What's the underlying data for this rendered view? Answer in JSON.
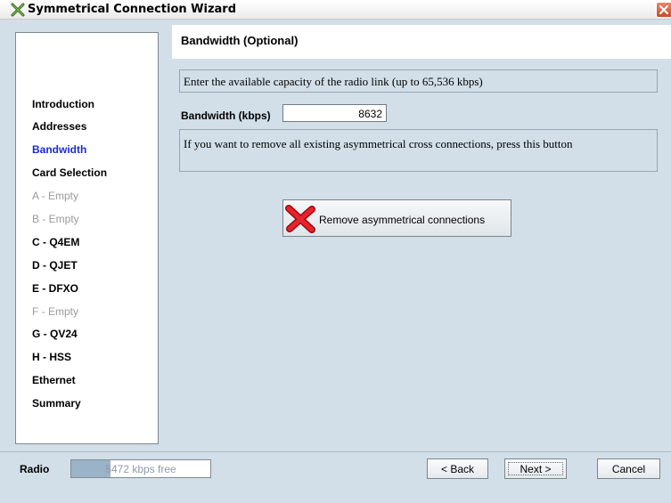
{
  "window": {
    "title": "Symmetrical Connection Wizard",
    "icon": "wizard-app-icon",
    "close_icon": "close-icon"
  },
  "nav": {
    "items": [
      {
        "label": "Introduction",
        "state": "done"
      },
      {
        "label": "Addresses",
        "state": "done"
      },
      {
        "label": "Bandwidth",
        "state": "active"
      },
      {
        "label": "Card Selection",
        "state": "done"
      },
      {
        "label": "A - Empty",
        "state": "disabled"
      },
      {
        "label": "B - Empty",
        "state": "disabled"
      },
      {
        "label": "C - Q4EM",
        "state": "done"
      },
      {
        "label": "D - QJET",
        "state": "done"
      },
      {
        "label": "E - DFXO",
        "state": "done"
      },
      {
        "label": "F - Empty",
        "state": "disabled"
      },
      {
        "label": "G - QV24",
        "state": "done"
      },
      {
        "label": "H - HSS",
        "state": "done"
      },
      {
        "label": "Ethernet",
        "state": "done"
      },
      {
        "label": "Summary",
        "state": "done"
      }
    ]
  },
  "page": {
    "heading": "Bandwidth (Optional)",
    "info": "Enter the available capacity of the radio link (up to 65,536 kbps)",
    "bandwidth_label": "Bandwidth (kbps)",
    "bandwidth_value": "8632",
    "remove_info": "If you want to remove all existing asymmetrical cross connections, press this button",
    "remove_button": "Remove asymmetrical connections",
    "remove_icon": "red-x-icon"
  },
  "footer": {
    "radio_label": "Radio",
    "progress_text": "5472 kbps free",
    "progress_fraction": 0.28,
    "back_label": "< Back",
    "next_label": "Next >",
    "cancel_label": "Cancel"
  },
  "colors": {
    "background": "#d2dfe8",
    "active_nav": "#1c2bd6",
    "disabled_nav": "#9a9a9a",
    "icon_red": "#d9141c"
  }
}
